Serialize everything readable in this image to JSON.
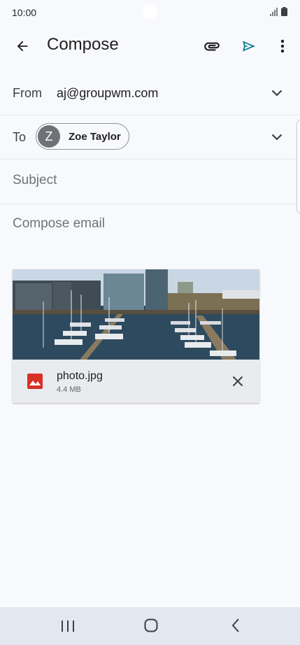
{
  "status_bar": {
    "time": "10:00",
    "icons": [
      "signal-icon",
      "battery-icon"
    ]
  },
  "app_bar": {
    "title": "Compose",
    "icons": [
      "back-arrow-icon",
      "attach-icon",
      "send-icon",
      "more-vert-icon"
    ],
    "send_color": "#0b7a8f"
  },
  "form": {
    "from_label": "From",
    "from_value": "aj@groupwm.com",
    "to_label": "To",
    "recipient": {
      "initial": "Z",
      "name": "Zoe Taylor"
    },
    "subject_placeholder": "Subject",
    "body_placeholder": "Compose email"
  },
  "attachment": {
    "file_name": "photo.jpg",
    "file_size": "4.4 MB",
    "icon": "image-file-icon",
    "icon_color": "#d93025"
  },
  "nav_bar": {
    "icons": [
      "recents-icon",
      "home-icon",
      "nav-back-icon"
    ]
  }
}
